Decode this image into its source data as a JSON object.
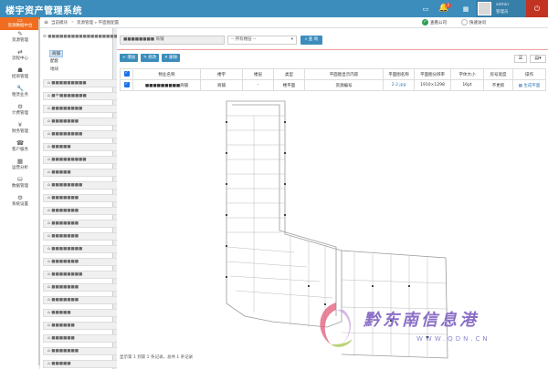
{
  "app": {
    "title": "楼宇资产管理系统"
  },
  "topbar": {
    "monitor_icon": "monitor-icon",
    "notification_count": "2",
    "user_name": "admin",
    "user_role": "管理员",
    "accent": "#3c8dbc",
    "power_color": "#c23321"
  },
  "breadcrumb": {
    "home_text": "当前模块",
    "sep": "»",
    "current": "资源管理 » 平面图配置"
  },
  "toggles": {
    "a_label": "查看公司",
    "b_label": "快速访问"
  },
  "leftnav": {
    "home": "资源数据中台",
    "items": [
      {
        "label": "资源管理",
        "icon": "✎"
      },
      {
        "label": "流程中心",
        "icon": "⇄"
      },
      {
        "label": "招商管理",
        "icon": "☗"
      },
      {
        "label": "租赁业务",
        "icon": "🔧"
      },
      {
        "label": "计费管理",
        "icon": "⚙"
      },
      {
        "label": "财务管理",
        "icon": "¥"
      },
      {
        "label": "客户服务",
        "icon": "☎"
      },
      {
        "label": "运营分析",
        "icon": "▦"
      },
      {
        "label": "数据管理",
        "icon": "⛁"
      },
      {
        "label": "系统设置",
        "icon": "⚙"
      }
    ]
  },
  "tree": {
    "root": "■■■■■■■■■■■■■■■■■■■■",
    "subitems": [
      "商铺",
      "配套",
      "地块"
    ],
    "rows": [
      "■■■■■■■■■",
      "■中■■■■■■■",
      "■■■■■■■■",
      "■■■■■■■",
      "■■■■■■■■",
      "■■■■■",
      "■■■■■■■■■",
      "■■■■■",
      "■■■■■■■■",
      "■■■■■■■",
      "■■■■■■■",
      "■■■■■■■",
      "■■■■■■■",
      "■■■■■■■■",
      "■■■■■■■",
      "■■■■■■■■",
      "■■■■■■■",
      "■■■■■■■",
      "■■■■■",
      "■■■■■■",
      "■■■■■■",
      "■■■■■■■",
      "■■■■■"
    ]
  },
  "toolbar": {
    "search_value": "■■■■■■■■ 商铺",
    "select_value": "-- 所有楼层 --",
    "search_btn": "查 询",
    "add_btn": "增加",
    "edit_btn": "修改",
    "delete_btn": "删除"
  },
  "table": {
    "headers": [
      "",
      "物业名称",
      "楼宇",
      "楼层",
      "类型",
      "平面图显示内容",
      "平面图名称",
      "平面图分辨率",
      "字体大小",
      "房号宽度",
      "操作"
    ],
    "rows": [
      [
        "",
        "■■■■■■■■■商铺",
        "商铺",
        "-",
        "楼平面",
        "资源编号",
        "2-2.jpg",
        "1910×1298",
        "16pt",
        "不更新",
        "生成平面"
      ]
    ]
  },
  "footer": {
    "text": "显示第 1 到第 1 条记录，总共 1 条记录"
  },
  "watermark": {
    "cn": "黔东南信息港",
    "url": "WWW.QDN.CN"
  }
}
